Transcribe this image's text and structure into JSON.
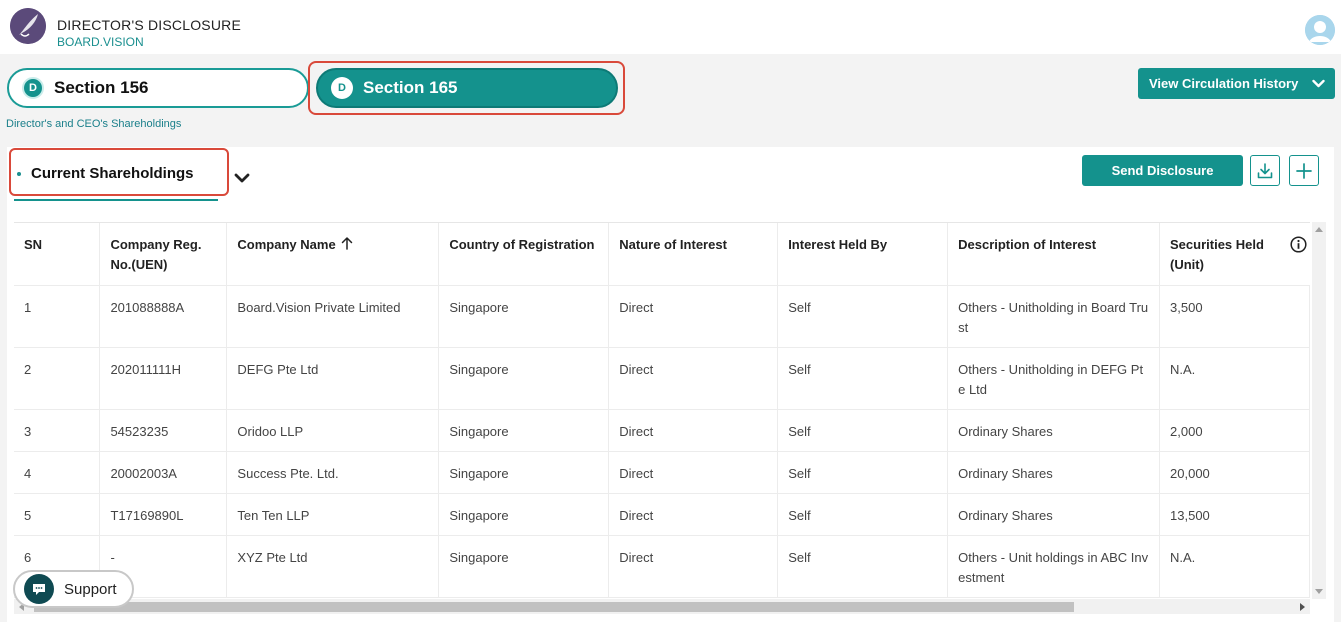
{
  "header": {
    "title": "DIRECTOR'S DISCLOSURE",
    "subtitle": "BOARD.VISION",
    "logo_icon": "feather-logo-icon",
    "avatar_icon": "user-avatar-icon"
  },
  "tabs": [
    {
      "badge": "D",
      "label": "Section 156",
      "active": false
    },
    {
      "badge": "D",
      "label": "Section 165",
      "active": true
    }
  ],
  "tab_caption": "Director's and CEO's Shareholdings",
  "view_history": {
    "label": "View Circulation History",
    "icon": "chevron-down-icon"
  },
  "section": {
    "title": "Current Shareholdings",
    "send_label": "Send Disclosure",
    "download_icon": "download-icon",
    "add_icon": "plus-icon"
  },
  "table": {
    "columns": [
      {
        "label": "SN"
      },
      {
        "label": "Company Reg. No.(UEN)"
      },
      {
        "label": "Company Name",
        "sort": "ascending"
      },
      {
        "label": "Country of Registration"
      },
      {
        "label": "Nature of Interest"
      },
      {
        "label": "Interest Held By"
      },
      {
        "label": "Description of Interest"
      },
      {
        "label": "Securities Held (Unit)"
      }
    ],
    "rows": [
      [
        "1",
        "201088888A",
        "Board.Vision Private Limited",
        "Singapore",
        "Direct",
        "Self",
        "Others - Unitholding in Board Trust",
        "3,500"
      ],
      [
        "2",
        "202011111H",
        "DEFG Pte Ltd",
        "Singapore",
        "Direct",
        "Self",
        "Others - Unitholding in DEFG Pte Ltd",
        "N.A."
      ],
      [
        "3",
        "54523235",
        "Oridoo LLP",
        "Singapore",
        "Direct",
        "Self",
        "Ordinary Shares",
        "2,000"
      ],
      [
        "4",
        "20002003A",
        "Success Pte. Ltd.",
        "Singapore",
        "Direct",
        "Self",
        "Ordinary Shares",
        "20,000"
      ],
      [
        "5",
        "T17169890L",
        "Ten Ten LLP",
        "Singapore",
        "Direct",
        "Self",
        "Ordinary Shares",
        "13,500"
      ],
      [
        "6",
        "-",
        "XYZ Pte Ltd",
        "Singapore",
        "Direct",
        "Self",
        "Others - Unit holdings in ABC Investment",
        "N.A."
      ]
    ]
  },
  "support": {
    "label": "Support",
    "icon": "chat-bubble-icon"
  },
  "colors": {
    "primary": "#14928d",
    "highlight": "#d9493a",
    "accent_text": "#1a8f8f"
  }
}
